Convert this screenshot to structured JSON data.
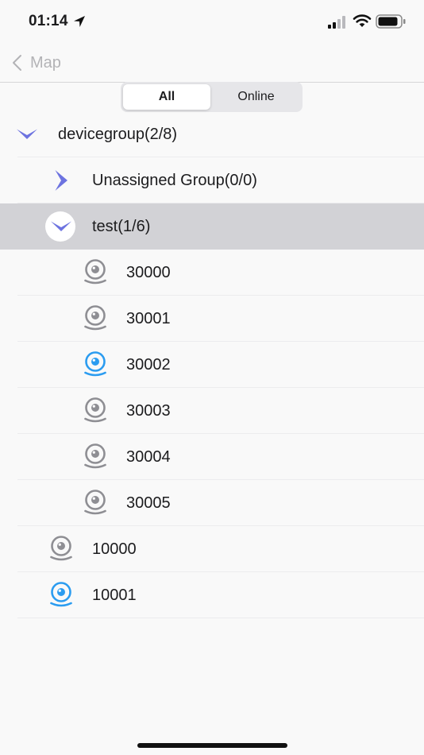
{
  "status_bar": {
    "time": "01:14"
  },
  "nav": {
    "back_label": "Map"
  },
  "segmented": {
    "all": "All",
    "online": "Online",
    "selected": "All"
  },
  "colors": {
    "accent": "#6d73e0",
    "online_icon": "#2b9cf0",
    "offline_icon": "#8e8e93",
    "selected_row": "#d2d2d6"
  },
  "tree": {
    "group": {
      "label": "devicegroup(2/8)",
      "expanded": true,
      "icon": "chevron-down-icon"
    },
    "unassigned": {
      "label": "Unassigned Group(0/0)",
      "expanded": false,
      "icon": "chevron-right-icon"
    },
    "test": {
      "label": "test(1/6)",
      "expanded": true,
      "icon": "chevron-down-icon"
    },
    "test_devices": [
      {
        "label": "30000",
        "status": "offline",
        "icon": "camera-icon"
      },
      {
        "label": "30001",
        "status": "offline",
        "icon": "camera-icon"
      },
      {
        "label": "30002",
        "status": "online",
        "icon": "camera-icon"
      },
      {
        "label": "30003",
        "status": "offline",
        "icon": "camera-icon"
      },
      {
        "label": "30004",
        "status": "offline",
        "icon": "camera-icon"
      },
      {
        "label": "30005",
        "status": "offline",
        "icon": "camera-icon"
      }
    ],
    "root_devices": [
      {
        "label": "10000",
        "status": "offline",
        "icon": "camera-icon"
      },
      {
        "label": "10001",
        "status": "online",
        "icon": "camera-icon"
      }
    ]
  }
}
